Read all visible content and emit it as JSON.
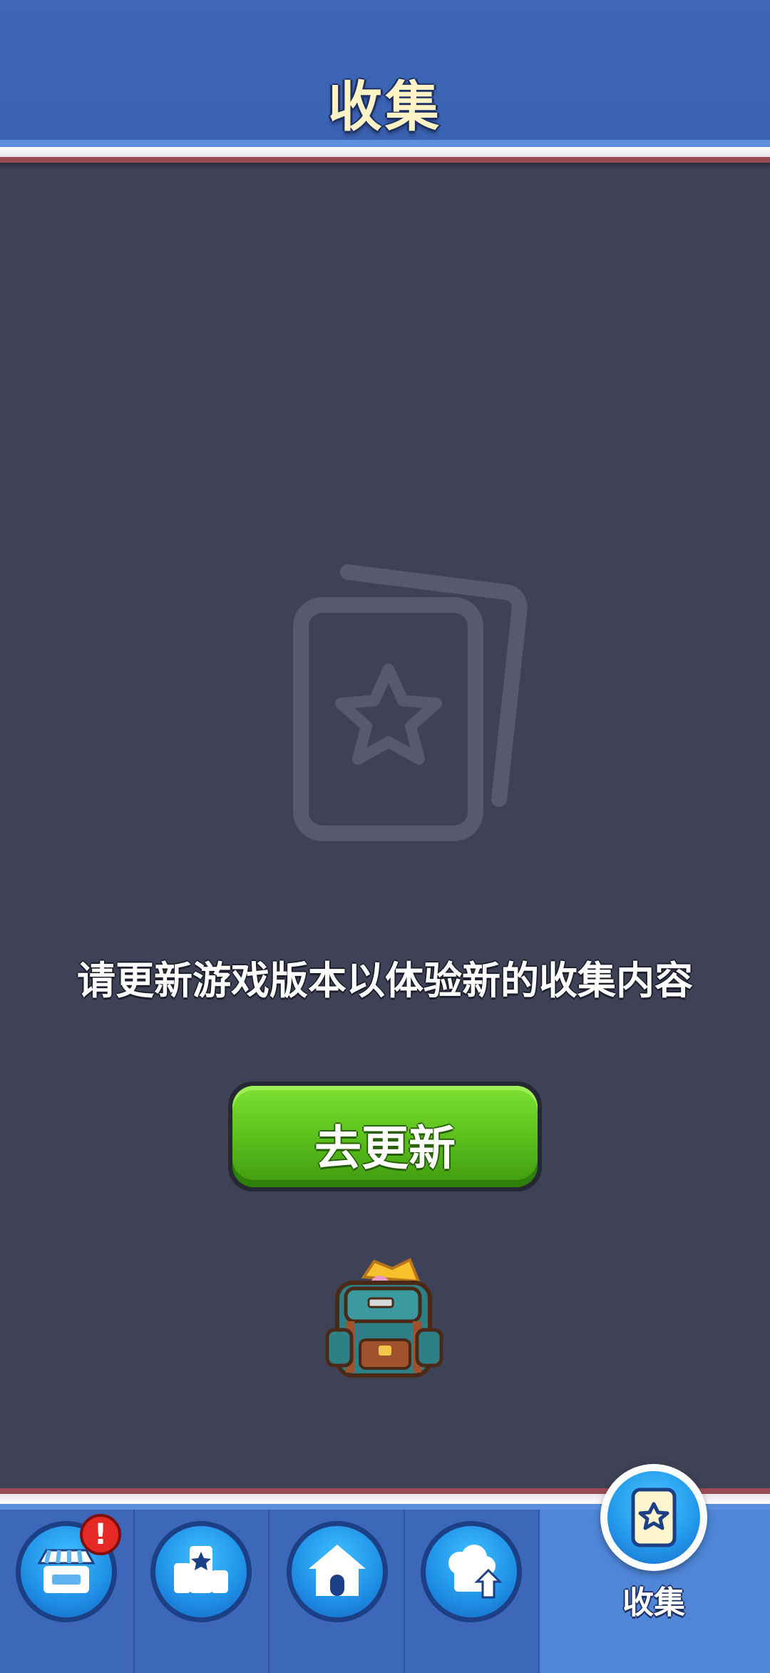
{
  "header": {
    "title": "收集"
  },
  "main": {
    "message": "请更新游戏版本以体验新的收集内容",
    "update_button_label": "去更新",
    "empty_icon": "card-stack-star-icon",
    "reward_icon": "backpack-icon"
  },
  "nav": {
    "items": [
      {
        "id": "shop",
        "icon": "shop-icon",
        "badge": "!"
      },
      {
        "id": "leaderboard",
        "icon": "leaderboard-icon"
      },
      {
        "id": "home",
        "icon": "home-icon"
      },
      {
        "id": "chef",
        "icon": "chef-upgrade-icon"
      },
      {
        "id": "collection",
        "icon": "card-star-icon",
        "label": "收集",
        "active": true
      }
    ]
  },
  "colors": {
    "background": "#3f4156",
    "header": "#3f67b6",
    "button_green": "#5fc41e",
    "title_text": "#fff3c6",
    "badge_red": "#e42a25"
  }
}
